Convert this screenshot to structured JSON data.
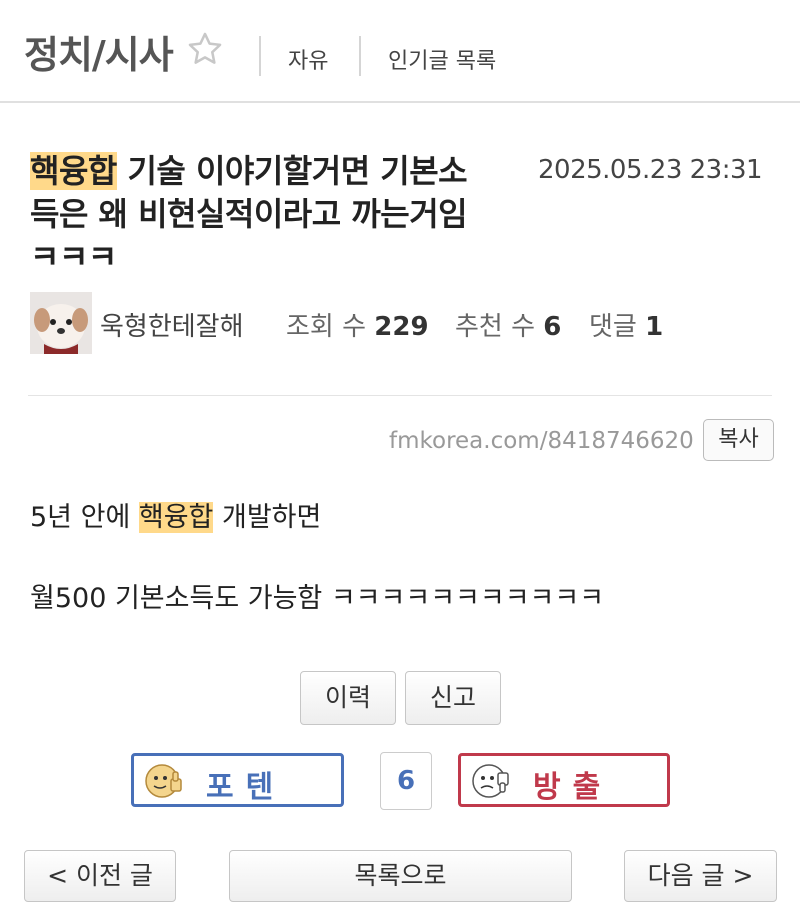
{
  "header": {
    "board_title": "정치/시사",
    "star_icon": "star-outline-icon",
    "nav_links": [
      "자유",
      "인기글 목록"
    ]
  },
  "post": {
    "title_highlight": "핵융합",
    "title_line1": " 기술 이야기할거면 기본소",
    "title_line2": "득은 왜 비현실적이라고 까는거임",
    "title_line3": "ㅋㅋㅋ",
    "date": "2025.05.23 23:31",
    "author": "욱형한테잘해",
    "views_label": "조회 수",
    "views": "229",
    "recommends_label": "추천 수",
    "recommends": "6",
    "comments_label": "댓글",
    "comments": "1",
    "url": "fmkorea.com/8418746620",
    "copy_label": "복사",
    "body_line1_prefix": "5년 안에 ",
    "body_line1_highlight": "핵융합",
    "body_line1_suffix": " 개발하면",
    "body_line2": "월500 기본소득도 가능함 ㅋㅋㅋㅋㅋㅋㅋㅋㅋㅋㅋ"
  },
  "actions": {
    "history_label": "이력",
    "report_label": "신고"
  },
  "vote": {
    "up_label": "포텐",
    "count": "6",
    "down_label": "방출",
    "up_color": "#4870b8",
    "down_color": "#c0394b"
  },
  "nav": {
    "prev_label": "< 이전 글",
    "list_label": "목록으로",
    "next_label": "다음 글 >"
  },
  "colors": {
    "highlight": "#ffd98a"
  }
}
